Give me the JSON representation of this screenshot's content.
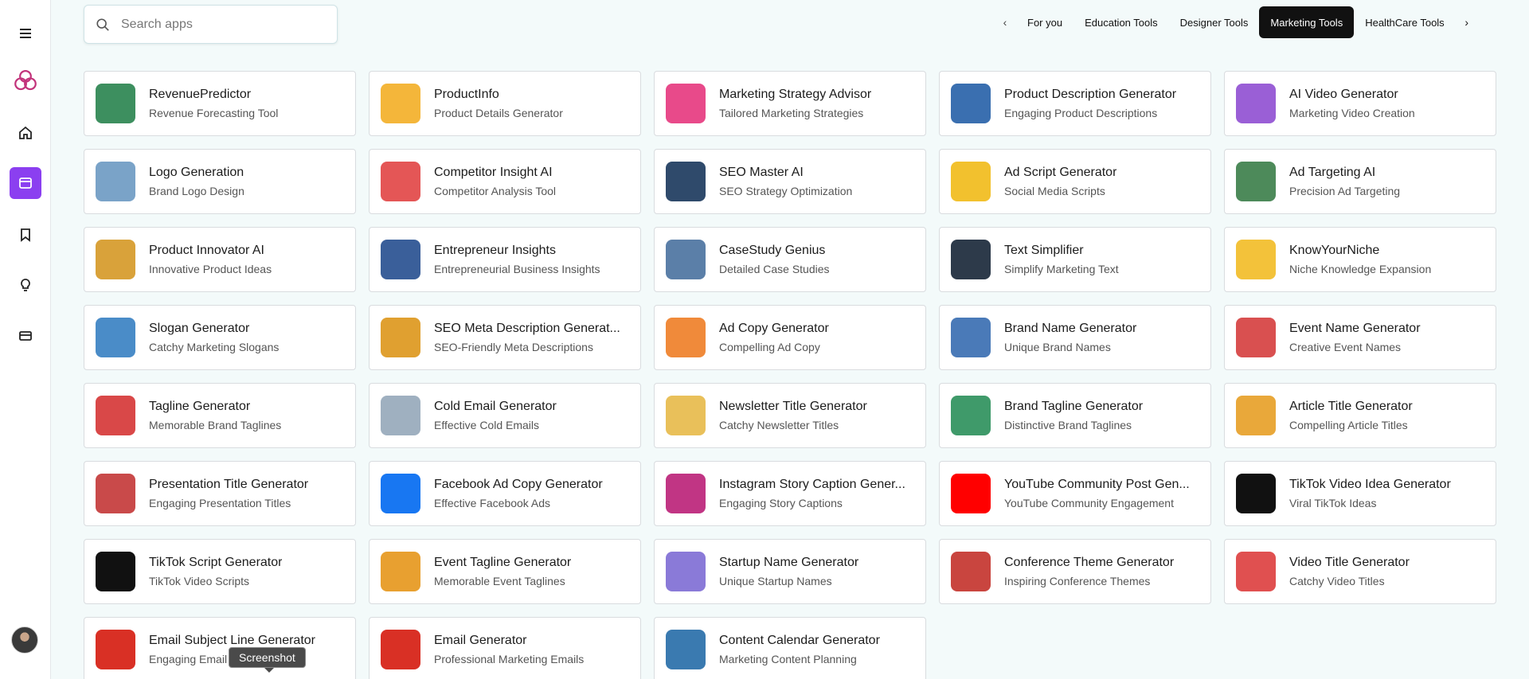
{
  "search": {
    "placeholder": "Search apps",
    "value": ""
  },
  "tabs": [
    {
      "label": "For you",
      "active": false
    },
    {
      "label": "Education Tools",
      "active": false
    },
    {
      "label": "Designer Tools",
      "active": false
    },
    {
      "label": "Marketing Tools",
      "active": true
    },
    {
      "label": "HealthCare Tools",
      "active": false
    }
  ],
  "sidebar": {
    "items": [
      {
        "icon": "menu-icon"
      },
      {
        "icon": "logo-icon"
      },
      {
        "icon": "home-icon"
      },
      {
        "icon": "apps-icon",
        "active": true
      },
      {
        "icon": "bookmark-icon"
      },
      {
        "icon": "bulb-icon"
      },
      {
        "icon": "card-icon"
      }
    ]
  },
  "apps": [
    {
      "title": "RevenuePredictor",
      "subtitle": "Revenue Forecasting Tool",
      "icon": "globe-chart-icon",
      "color": "#3d8f5f"
    },
    {
      "title": "ProductInfo",
      "subtitle": "Product Details Generator",
      "icon": "box-icon",
      "color": "#f4b63a"
    },
    {
      "title": "Marketing Strategy Advisor",
      "subtitle": "Tailored Marketing Strategies",
      "icon": "calendar-icon",
      "color": "#e84a8a"
    },
    {
      "title": "Product Description Generator",
      "subtitle": "Engaging Product Descriptions",
      "icon": "idea-box-icon",
      "color": "#3a6fb0"
    },
    {
      "title": "AI Video Generator",
      "subtitle": "Marketing Video Creation",
      "icon": "video-icon",
      "color": "#9a5fd6"
    },
    {
      "title": "Logo Generation",
      "subtitle": "Brand Logo Design",
      "icon": "logo-design-icon",
      "color": "#7aa3c8"
    },
    {
      "title": "Competitor Insight AI",
      "subtitle": "Competitor Analysis Tool",
      "icon": "versus-icon",
      "color": "#e45656"
    },
    {
      "title": "SEO Master AI",
      "subtitle": "SEO Strategy Optimization",
      "icon": "seo-icon",
      "color": "#2f4a6b"
    },
    {
      "title": "Ad Script Generator",
      "subtitle": "Social Media Scripts",
      "icon": "ads-hand-icon",
      "color": "#f2c12e"
    },
    {
      "title": "Ad Targeting AI",
      "subtitle": "Precision Ad Targeting",
      "icon": "megaphone-icon",
      "color": "#4d8a5a"
    },
    {
      "title": "Product Innovator AI",
      "subtitle": "Innovative Product Ideas",
      "icon": "innovation-icon",
      "color": "#d9a23a"
    },
    {
      "title": "Entrepreneur Insights",
      "subtitle": "Entrepreneurial Business Insights",
      "icon": "entrepreneur-icon",
      "color": "#3a5f9a"
    },
    {
      "title": "CaseStudy Genius",
      "subtitle": "Detailed Case Studies",
      "icon": "case-study-icon",
      "color": "#5b7fa8"
    },
    {
      "title": "Text Simplifier",
      "subtitle": "Simplify Marketing Text",
      "icon": "txt-file-icon",
      "color": "#2d3a4a"
    },
    {
      "title": "KnowYourNiche",
      "subtitle": "Niche Knowledge Expansion",
      "icon": "nerd-face-icon",
      "color": "#f3c23a"
    },
    {
      "title": "Slogan Generator",
      "subtitle": "Catchy Marketing Slogans",
      "icon": "slogan-icon",
      "color": "#4a8cc8"
    },
    {
      "title": "SEO Meta Description Generat...",
      "subtitle": "SEO-Friendly Meta Descriptions",
      "icon": "meta-doc-icon",
      "color": "#e0a030"
    },
    {
      "title": "Ad Copy Generator",
      "subtitle": "Compelling Ad Copy",
      "icon": "ad-copy-icon",
      "color": "#f08a3a"
    },
    {
      "title": "Brand Name Generator",
      "subtitle": "Unique Brand Names",
      "icon": "tag-icon",
      "color": "#4a7ab8"
    },
    {
      "title": "Event Name Generator",
      "subtitle": "Creative Event Names",
      "icon": "crowd-icon",
      "color": "#d95050"
    },
    {
      "title": "Tagline Generator",
      "subtitle": "Memorable Brand Taglines",
      "icon": "badge-pen-icon",
      "color": "#d94848"
    },
    {
      "title": "Cold Email Generator",
      "subtitle": "Effective Cold Emails",
      "icon": "at-mail-icon",
      "color": "#9fb0c0"
    },
    {
      "title": "Newsletter Title Generator",
      "subtitle": "Catchy Newsletter Titles",
      "icon": "newsletter-icon",
      "color": "#e9c05a"
    },
    {
      "title": "Brand Tagline Generator",
      "subtitle": "Distinctive Brand Taglines",
      "icon": "award-icon",
      "color": "#3f9a6a"
    },
    {
      "title": "Article Title Generator",
      "subtitle": "Compelling Article Titles",
      "icon": "title-banner-icon",
      "color": "#e9a83a"
    },
    {
      "title": "Presentation Title Generator",
      "subtitle": "Engaging Presentation Titles",
      "icon": "presenter-icon",
      "color": "#c94a4a"
    },
    {
      "title": "Facebook Ad Copy Generator",
      "subtitle": "Effective Facebook Ads",
      "icon": "facebook-icon",
      "color": "#1877f2"
    },
    {
      "title": "Instagram Story Caption Gener...",
      "subtitle": "Engaging Story Captions",
      "icon": "instagram-icon",
      "color": "#c13584"
    },
    {
      "title": "YouTube Community Post Gen...",
      "subtitle": "YouTube Community Engagement",
      "icon": "youtube-icon",
      "color": "#ff0000"
    },
    {
      "title": "TikTok Video Idea Generator",
      "subtitle": "Viral TikTok Ideas",
      "icon": "tiktok-icon",
      "color": "#111111"
    },
    {
      "title": "TikTok Script Generator",
      "subtitle": "TikTok Video Scripts",
      "icon": "tiktok-icon",
      "color": "#111111"
    },
    {
      "title": "Event Tagline Generator",
      "subtitle": "Memorable Event Taglines",
      "icon": "event-sign-icon",
      "color": "#e8a030"
    },
    {
      "title": "Startup Name Generator",
      "subtitle": "Unique Startup Names",
      "icon": "rocket-icon",
      "color": "#8a7ad8"
    },
    {
      "title": "Conference Theme Generator",
      "subtitle": "Inspiring Conference Themes",
      "icon": "notebook-icon",
      "color": "#c9453f"
    },
    {
      "title": "Video Title Generator",
      "subtitle": "Catchy Video Titles",
      "icon": "video-edit-icon",
      "color": "#e05050"
    },
    {
      "title": "Email Subject Line Generator",
      "subtitle": "Engaging Email",
      "icon": "gmail-icon",
      "color": "#d93025"
    },
    {
      "title": "Email Generator",
      "subtitle": "Professional Marketing Emails",
      "icon": "gmail-icon",
      "color": "#d93025"
    },
    {
      "title": "Content Calendar Generator",
      "subtitle": "Marketing Content Planning",
      "icon": "content-plan-icon",
      "color": "#3a7ab0"
    }
  ],
  "tooltip": {
    "label": "Screenshot"
  }
}
